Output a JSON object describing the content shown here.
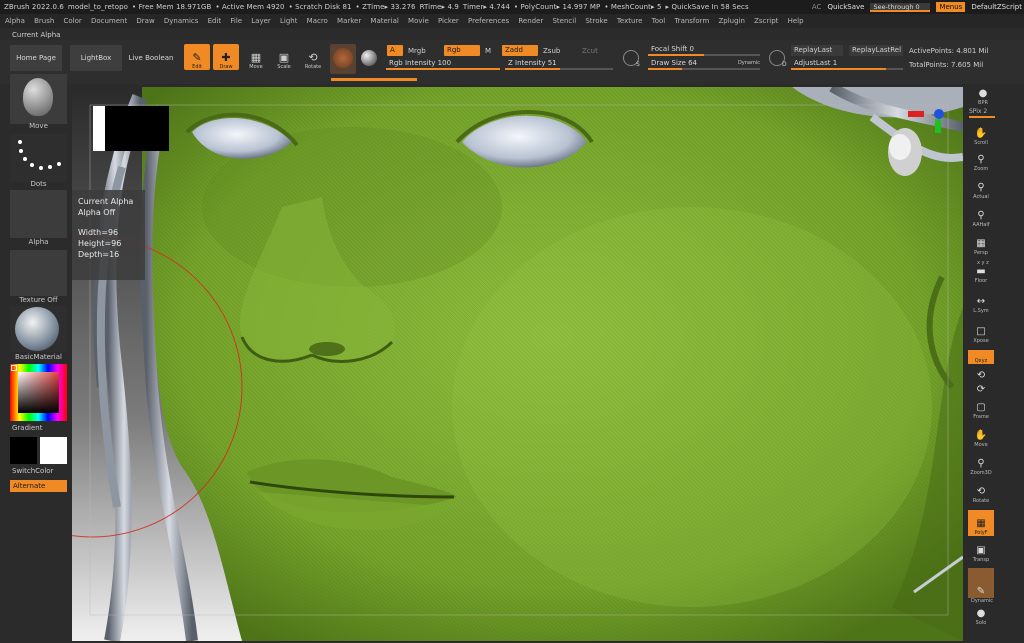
{
  "titlebar": {
    "app": "ZBrush 2022.0.6",
    "file": "model_to_retopo",
    "free_mem": "• Free Mem 18.971GB",
    "active_mem": "• Active Mem 4920",
    "scratch": "• Scratch Disk 81",
    "ztime": "• ZTime▸ 33.276",
    "rtime": "RTime▸ 4.9",
    "timer": "Timer▸ 4.744",
    "polycount": "• PolyCount▸ 14.997 MP",
    "meshcount": "• MeshCount▸ 5",
    "quicksave_in": "▸ QuickSave In 58 Secs",
    "ac": "AC",
    "quicksave": "QuickSave",
    "see_through": "See-through  0",
    "menus": "Menus",
    "default_zscript": "DefaultZScript"
  },
  "menubar": [
    "Alpha",
    "Brush",
    "Color",
    "Document",
    "Draw",
    "Dynamics",
    "Edit",
    "File",
    "Layer",
    "Light",
    "Macro",
    "Marker",
    "Material",
    "Movie",
    "Picker",
    "Preferences",
    "Render",
    "Stencil",
    "Stroke",
    "Texture",
    "Tool",
    "Transform",
    "Zplugin",
    "Zscript",
    "Help"
  ],
  "current_alpha_label": "Current Alpha",
  "shelf": {
    "home_page": "Home Page",
    "lightbox": "LightBox",
    "live_boolean": "Live Boolean",
    "edit": "Edit",
    "draw": "Draw",
    "move": "Move",
    "scale": "Scale",
    "rotate": "Rotate",
    "a": "A",
    "mrgb": "Mrgb",
    "rgb": "Rgb",
    "m": "M",
    "zadd": "Zadd",
    "zsub": "Zsub",
    "zcut": "Zcut",
    "rgb_intensity": "Rgb Intensity 100",
    "z_intensity": "Z Intensity 51",
    "focal_shift": "Focal Shift 0",
    "draw_size": "Draw Size 64",
    "dynamic": "Dynamic",
    "replay_last": "ReplayLast",
    "replay_last_rel": "ReplayLastRel",
    "adjust_last": "AdjustLast 1",
    "active_points": "ActivePoints: 4.801 Mil",
    "total_points": "TotalPoints: 7.605 Mil",
    "s_label": "S",
    "d_label": "D"
  },
  "sliders": {
    "rgb_intensity": 1.0,
    "z_intensity": 0.51,
    "focal_shift": 0.5,
    "draw_size": 0.3,
    "adjust_last": 0.85
  },
  "left_tray": {
    "move": "Move",
    "dots": "Dots",
    "alpha": "Alpha",
    "texture_off": "Texture Off",
    "basic_material": "BasicMaterial",
    "gradient": "Gradient",
    "switch_color": "SwitchColor",
    "alternate": "Alternate"
  },
  "tooltip": {
    "title": "Current Alpha",
    "state": "Alpha Off",
    "width": "Width=96",
    "height": "Height=96",
    "depth": "Depth=16"
  },
  "right_tray": {
    "bpr": "BPR",
    "spix": "SPix 2",
    "scroll": "Scroll",
    "zoom": "Zoom",
    "actual": "Actual",
    "aahalf": "AAHalf",
    "persp": "Persp",
    "xyz_axes": "x y z",
    "floor": "Floor",
    "lsym": "L.Sym",
    "xpose": "Xpose",
    "qxyz": "Qxyz",
    "frame": "Frame",
    "move": "Move",
    "zoom3d": "Zoom3D",
    "rotate": "Rotate",
    "polyf": "PolyF",
    "transp": "Transp",
    "dynamic": "Dynamic",
    "solo": "Solo"
  },
  "colors": {
    "accent": "#f08a24",
    "skin": "#7fae2f",
    "panel": "#2b2b2b"
  }
}
